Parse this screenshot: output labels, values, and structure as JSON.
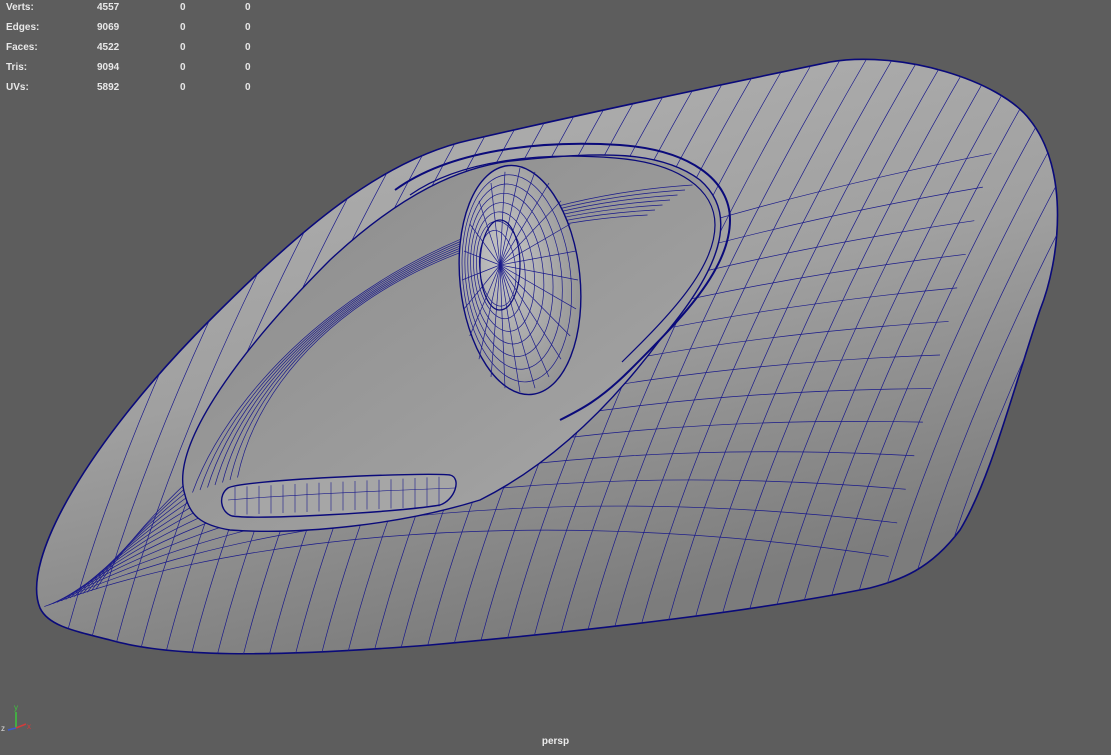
{
  "hud": {
    "rows": [
      {
        "label": "Verts:",
        "total": "4557",
        "selected": "0",
        "component": "0"
      },
      {
        "label": "Edges:",
        "total": "9069",
        "selected": "0",
        "component": "0"
      },
      {
        "label": "Faces:",
        "total": "4522",
        "selected": "0",
        "component": "0"
      },
      {
        "label": "Tris:",
        "total": "9094",
        "selected": "0",
        "component": "0"
      },
      {
        "label": "UVs:",
        "total": "5892",
        "selected": "0",
        "component": "0"
      }
    ]
  },
  "viewport": {
    "camera": "persp",
    "background_color": "#5d5d5d",
    "wireframe_color": "#0a0a7a",
    "mesh_color": "#9c9c9c"
  },
  "axis": {
    "y_label": "y",
    "z_label": "z",
    "x_label": "x"
  }
}
